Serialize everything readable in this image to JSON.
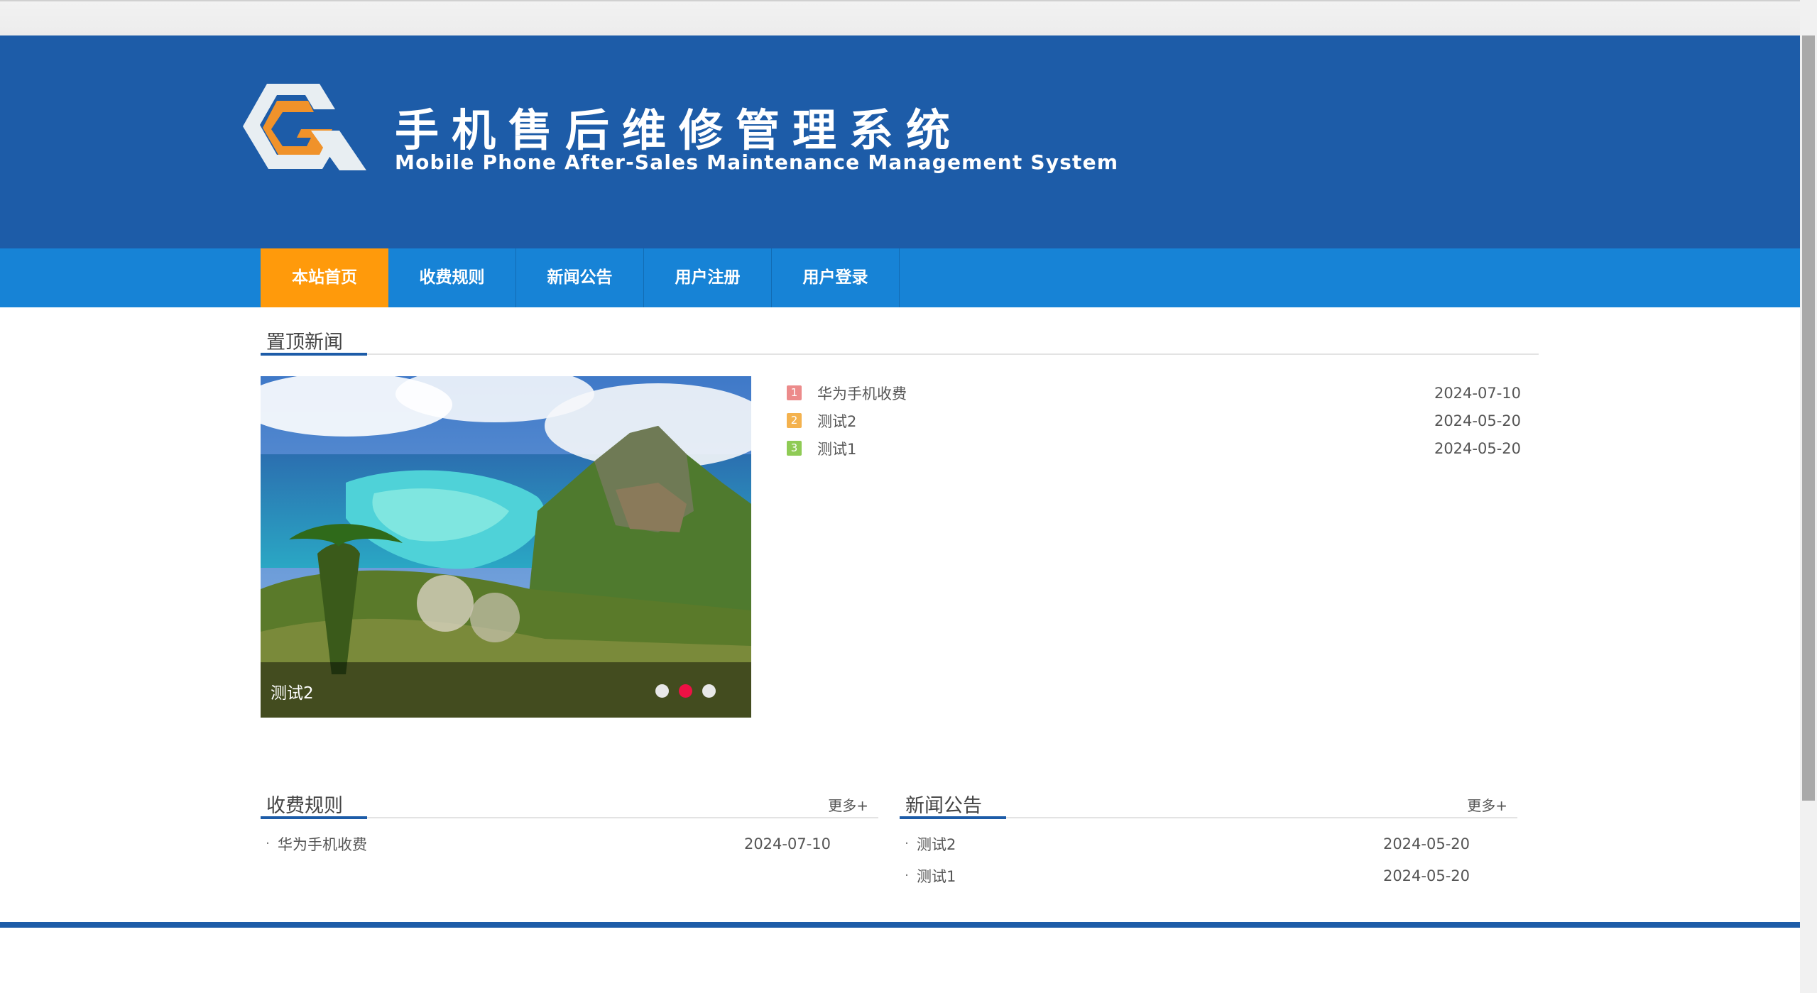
{
  "site": {
    "title": "手机售后维修管理系统",
    "subtitle": "Mobile Phone After-Sales Maintenance Management System",
    "logo_icon": "cg-logo-icon",
    "colors": {
      "header": "#1d5ca8",
      "nav": "#1783d6",
      "nav_active": "#ff9a0b",
      "dot_active": "#ee1144"
    }
  },
  "nav": {
    "items": [
      {
        "label": "本站首页",
        "active": true
      },
      {
        "label": "收费规则"
      },
      {
        "label": "新闻公告"
      },
      {
        "label": "用户注册"
      },
      {
        "label": "用户登录"
      }
    ]
  },
  "top_news": {
    "section_title": "置顶新闻",
    "slider": {
      "caption": "测试2",
      "dots": 3,
      "active_dot": 2,
      "image": "island-landscape-photo"
    },
    "items": [
      {
        "rank": "1",
        "title": "华为手机收费",
        "date": "2024-07-10"
      },
      {
        "rank": "2",
        "title": "测试2",
        "date": "2024-05-20"
      },
      {
        "rank": "3",
        "title": "测试1",
        "date": "2024-05-20"
      }
    ]
  },
  "fee_rules": {
    "section_title": "收费规则",
    "more": "更多+",
    "items": [
      {
        "bullet": "·",
        "title": "华为手机收费",
        "date": "2024-07-10"
      }
    ]
  },
  "news": {
    "section_title": "新闻公告",
    "more": "更多+",
    "items": [
      {
        "bullet": "·",
        "title": "测试2",
        "date": "2024-05-20"
      },
      {
        "bullet": "·",
        "title": "测试1",
        "date": "2024-05-20"
      }
    ]
  }
}
